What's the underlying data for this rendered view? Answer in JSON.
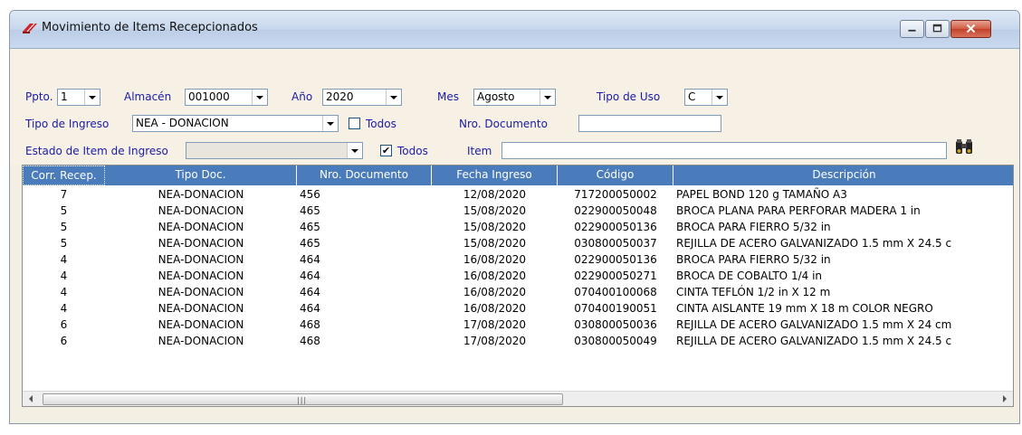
{
  "window": {
    "title": "Movimiento de Items Recepcionados",
    "icon": "eraser-icon"
  },
  "filters": {
    "ppto_label": "Ppto.",
    "ppto_value": "1",
    "almacen_label": "Almacén",
    "almacen_value": "001000",
    "anio_label": "Año",
    "anio_value": "2020",
    "mes_label": "Mes",
    "mes_value": "Agosto",
    "tipo_uso_label": "Tipo de Uso",
    "tipo_uso_value": "C",
    "tipo_ingreso_label": "Tipo de Ingreso",
    "tipo_ingreso_value": "NEA - DONACION",
    "todos1_label": "Todos",
    "todos1_checked": false,
    "nro_documento_label": "Nro. Documento",
    "nro_documento_value": "",
    "estado_label": "Estado de Item de Ingreso",
    "estado_value": "",
    "todos2_label": "Todos",
    "todos2_checked": true,
    "item_label": "Item",
    "item_value": "",
    "search_icon": "binoculars-icon"
  },
  "grid": {
    "headers": [
      "Corr. Recep.",
      "Tipo Doc.",
      "Nro. Documento",
      "Fecha Ingreso",
      "Código",
      "Descripción"
    ],
    "rows": [
      [
        "7",
        "NEA-DONACION",
        "456",
        "12/08/2020",
        "717200050002",
        "PAPEL BOND 120 g TAMAÑO A3"
      ],
      [
        "5",
        "NEA-DONACION",
        "465",
        "15/08/2020",
        "022900050048",
        "BROCA PLANA PARA PERFORAR MADERA 1 in"
      ],
      [
        "5",
        "NEA-DONACION",
        "465",
        "15/08/2020",
        "022900050136",
        "BROCA PARA FIERRO 5/32 in"
      ],
      [
        "5",
        "NEA-DONACION",
        "465",
        "15/08/2020",
        "030800050037",
        "REJILLA DE ACERO GALVANIZADO 1.5 mm X 24.5 c"
      ],
      [
        "4",
        "NEA-DONACION",
        "464",
        "16/08/2020",
        "022900050136",
        "BROCA PARA FIERRO 5/32 in"
      ],
      [
        "4",
        "NEA-DONACION",
        "464",
        "16/08/2020",
        "022900050271",
        "BROCA DE COBALTO 1/4 in"
      ],
      [
        "4",
        "NEA-DONACION",
        "464",
        "16/08/2020",
        "070400100068",
        "CINTA TEFLÓN 1/2 in X 12 m"
      ],
      [
        "4",
        "NEA-DONACION",
        "464",
        "16/08/2020",
        "070400190051",
        "CINTA AISLANTE 19 mm X 18 m COLOR NEGRO"
      ],
      [
        "6",
        "NEA-DONACION",
        "468",
        "17/08/2020",
        "030800050036",
        "REJILLA DE ACERO GALVANIZADO 1.5 mm X 24 cm"
      ],
      [
        "6",
        "NEA-DONACION",
        "468",
        "17/08/2020",
        "030800050049",
        "REJILLA DE ACERO GALVANIZADO 1.5 mm X 24.5 c"
      ]
    ],
    "scroll_left_icon": "scroll-left-icon",
    "scroll_right_icon": "scroll-right-icon"
  },
  "colors": {
    "header_bg": "#4a7bbb",
    "label_text": "#1a1aa6",
    "panel_bg": "#f6f1e4"
  }
}
